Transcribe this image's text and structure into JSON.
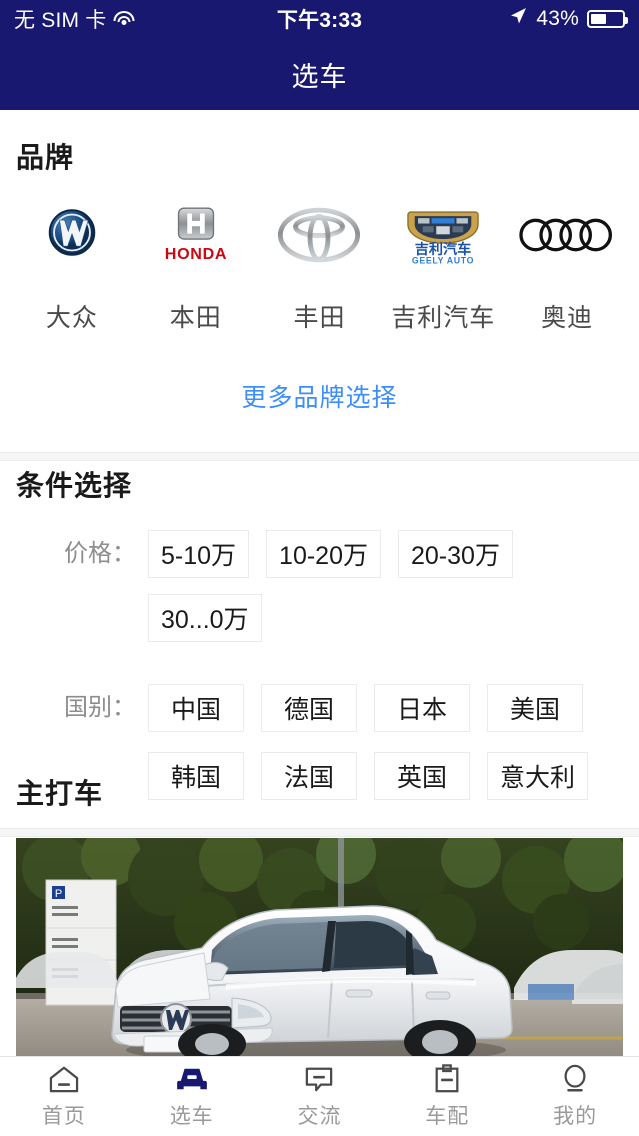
{
  "status_bar": {
    "carrier": "无 SIM 卡",
    "wifi_icon": "wifi-icon",
    "time": "下午3:33",
    "location_icon": "location-arrow-icon",
    "battery_percent": "43%",
    "battery_level": 43
  },
  "header": {
    "title": "选车"
  },
  "brand_section": {
    "title": "品牌",
    "brands": [
      {
        "name": "大众",
        "logo": "volkswagen-logo",
        "wordmark": "Volkswagen"
      },
      {
        "name": "本田",
        "logo": "honda-logo",
        "wordmark": "HONDA"
      },
      {
        "name": "丰田",
        "logo": "toyota-logo",
        "wordmark": ""
      },
      {
        "name": "吉利汽车",
        "logo": "geely-logo",
        "wordmark": "吉利汽车",
        "wordmark_sub": "GEELY AUTO"
      },
      {
        "name": "奥迪",
        "logo": "audi-logo",
        "wordmark": ""
      }
    ],
    "more_link": "更多品牌选择"
  },
  "filter_section": {
    "title": "条件选择",
    "price": {
      "label": "价格：",
      "options": [
        "5-10万",
        "10-20万",
        "20-30万",
        "30...0万"
      ]
    },
    "country": {
      "label": "国别：",
      "options_row1": [
        "中国",
        "德国",
        "日本",
        "美国"
      ],
      "options_row2": [
        "韩国",
        "法国",
        "英国",
        "意大利"
      ]
    }
  },
  "feature_section": {
    "title": "主打车",
    "photo_alt": "white-volkswagen-sedan-dealership-lot"
  },
  "tabbar": {
    "items": [
      {
        "label": "首页",
        "icon": "home-icon",
        "active": false
      },
      {
        "label": "选车",
        "icon": "car-icon",
        "active": true
      },
      {
        "label": "交流",
        "icon": "chat-bubble-icon",
        "active": false
      },
      {
        "label": "车配",
        "icon": "clipboard-icon",
        "active": false
      },
      {
        "label": "我的",
        "icon": "person-icon",
        "active": false
      }
    ]
  },
  "colors": {
    "brand_navy": "#191870",
    "link_blue": "#3c8efc",
    "text_dark": "#1a1a1a",
    "text_muted": "#8d8d8d",
    "tab_inactive": "#9a9a9a",
    "chip_border": "#ebebeb"
  }
}
